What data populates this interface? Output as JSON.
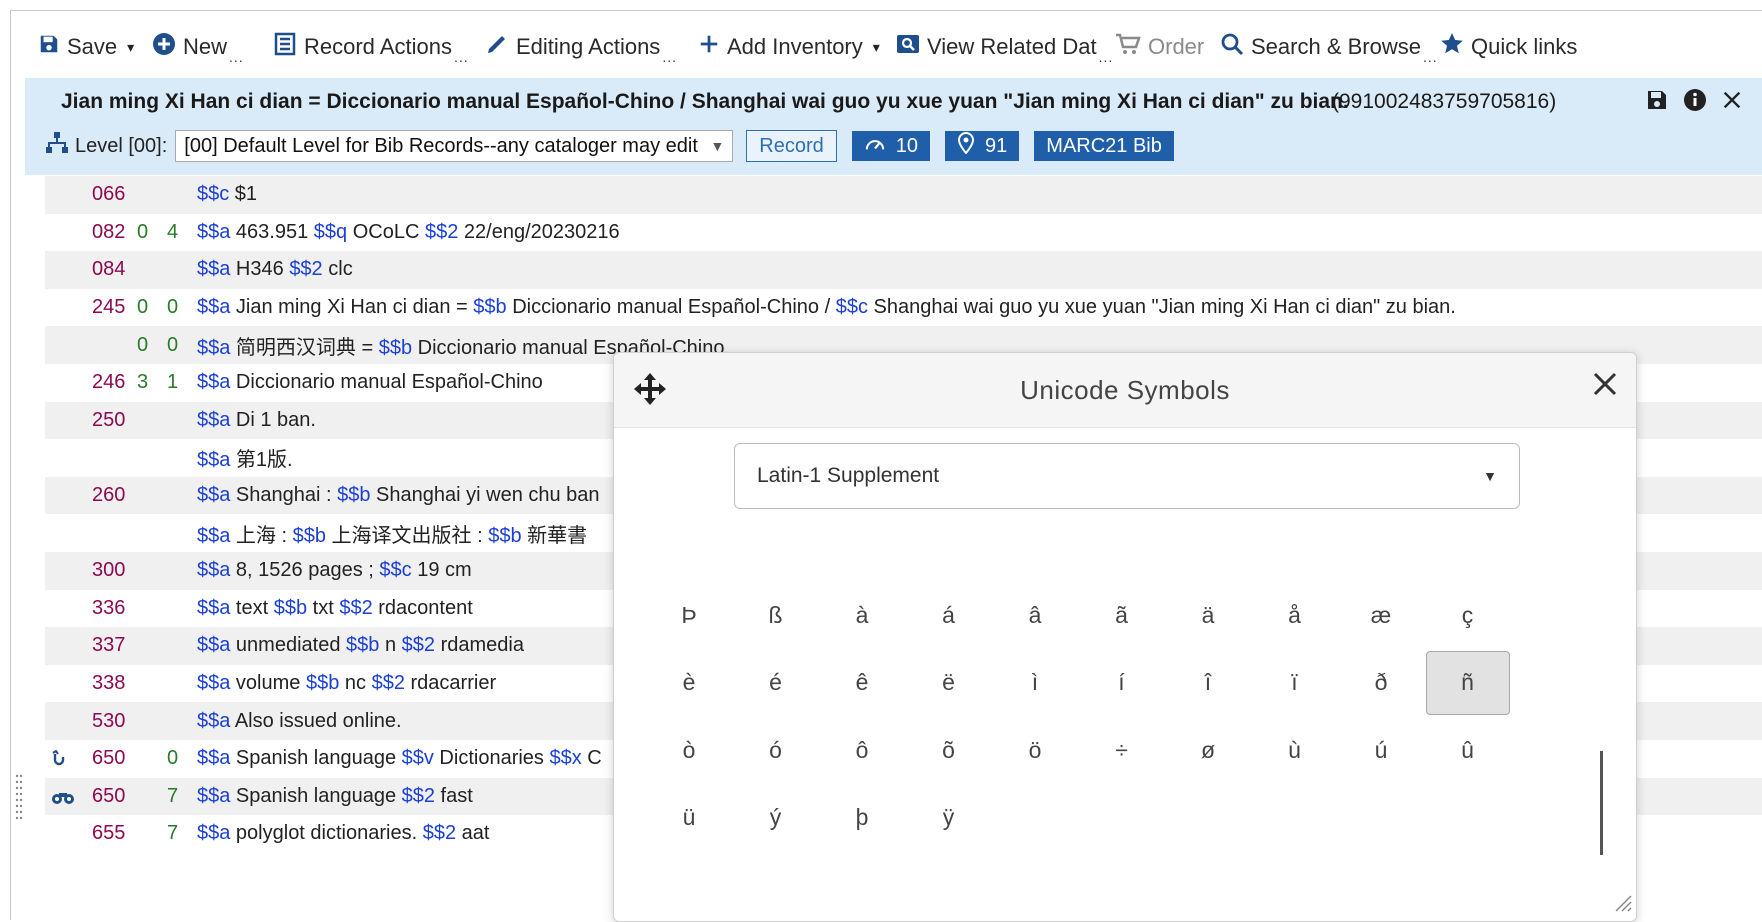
{
  "toolbar": {
    "save": "Save",
    "new": "New",
    "record_actions": "Record Actions",
    "editing_actions": "Editing Actions",
    "add_inventory": "Add Inventory",
    "view_related": "View Related Dat",
    "order": "Order",
    "search_browse": "Search & Browse",
    "quick_links": "Quick links",
    "more": "...",
    "caret": "▾"
  },
  "header": {
    "title": "Jian ming Xi Han ci dian = Diccionario manual Español-Chino / Shanghai wai guo yu xue yuan \"Jian ming Xi Han ci dian\" zu bian.",
    "record_id": "(991002483759705816)",
    "level_label": "Level [00]:",
    "level_value": "[00] Default Level for Bib Records--any cataloger may edit",
    "record_button": "Record",
    "badge_views": "10",
    "badge_location": "91",
    "badge_format": "MARC21 Bib",
    "accent": "#1f5ea8"
  },
  "marc": {
    "rows": [
      {
        "tag": "066",
        "i1": "",
        "i2": "",
        "parts": [
          [
            "$$c",
            " $1"
          ]
        ]
      },
      {
        "tag": "082",
        "i1": "0",
        "i2": "4",
        "parts": [
          [
            "$$a",
            " 463.951 "
          ],
          [
            "$$q",
            " OCoLC "
          ],
          [
            "$$2",
            " 22/eng/20230216"
          ]
        ]
      },
      {
        "tag": "084",
        "i1": "",
        "i2": "",
        "parts": [
          [
            "$$a",
            " H346 "
          ],
          [
            "$$2",
            " clc"
          ]
        ]
      },
      {
        "tag": "245",
        "i1": "0",
        "i2": "0",
        "parts": [
          [
            "$$a",
            " Jian ming Xi Han ci dian = "
          ],
          [
            "$$b",
            " Diccionario manual Español-Chino / "
          ],
          [
            "$$c",
            " Shanghai wai guo yu xue yuan \"Jian ming Xi Han ci dian\" zu bian."
          ]
        ]
      },
      {
        "tag": "",
        "i1": "0",
        "i2": "0",
        "parts": [
          [
            "$$a",
            " 简明西汉词典 = "
          ],
          [
            "$$b",
            " Diccionario manual Español-Chino"
          ]
        ]
      },
      {
        "tag": "246",
        "i1": "3",
        "i2": "1",
        "parts": [
          [
            "$$a",
            " Diccionario manual Español-Chino"
          ]
        ]
      },
      {
        "tag": "250",
        "i1": "",
        "i2": "",
        "parts": [
          [
            "$$a",
            " Di 1 ban."
          ]
        ]
      },
      {
        "tag": "",
        "i1": "",
        "i2": "",
        "parts": [
          [
            "$$a",
            " 第1版."
          ]
        ]
      },
      {
        "tag": "260",
        "i1": "",
        "i2": "",
        "parts": [
          [
            "$$a",
            " Shanghai : "
          ],
          [
            "$$b",
            " Shanghai yi wen chu ban"
          ]
        ]
      },
      {
        "tag": "",
        "i1": "",
        "i2": "",
        "parts": [
          [
            "$$a",
            " 上海 : "
          ],
          [
            "$$b",
            " 上海译文出版社 : "
          ],
          [
            "$$b",
            " 新華書"
          ]
        ]
      },
      {
        "tag": "300",
        "i1": "",
        "i2": "",
        "parts": [
          [
            "$$a",
            " 8, 1526 pages ; "
          ],
          [
            "$$c",
            " 19 cm"
          ]
        ]
      },
      {
        "tag": "336",
        "i1": "",
        "i2": "",
        "parts": [
          [
            "$$a",
            " text "
          ],
          [
            "$$b",
            " txt "
          ],
          [
            "$$2",
            " rdacontent"
          ]
        ]
      },
      {
        "tag": "337",
        "i1": "",
        "i2": "",
        "parts": [
          [
            "$$a",
            " unmediated "
          ],
          [
            "$$b",
            " n "
          ],
          [
            "$$2",
            " rdamedia"
          ]
        ]
      },
      {
        "tag": "338",
        "i1": "",
        "i2": "",
        "parts": [
          [
            "$$a",
            " volume "
          ],
          [
            "$$b",
            " nc "
          ],
          [
            "$$2",
            " rdacarrier"
          ]
        ]
      },
      {
        "tag": "530",
        "i1": "",
        "i2": "",
        "parts": [
          [
            "$$a",
            " Also issued online."
          ]
        ]
      },
      {
        "tag": "650",
        "i1": "",
        "i2": "0",
        "icon": "link-icon",
        "parts": [
          [
            "$$a",
            " Spanish language "
          ],
          [
            "$$v",
            " Dictionaries "
          ],
          [
            "$$x",
            " C"
          ]
        ]
      },
      {
        "tag": "650",
        "i1": "",
        "i2": "7",
        "icon": "binoculars-icon",
        "parts": [
          [
            "$$a",
            " Spanish language "
          ],
          [
            "$$2",
            " fast"
          ]
        ]
      },
      {
        "tag": "655",
        "i1": "",
        "i2": "7",
        "parts": [
          [
            "$$a",
            " polyglot dictionaries. "
          ],
          [
            "$$2",
            " aat"
          ]
        ]
      }
    ]
  },
  "dialog": {
    "title": "Unicode Symbols",
    "block_select": "Latin-1 Supplement",
    "symbols": [
      "Þ",
      "ß",
      "à",
      "á",
      "â",
      "ã",
      "ä",
      "å",
      "æ",
      "ç",
      "è",
      "é",
      "ê",
      "ë",
      "ì",
      "í",
      "î",
      "ï",
      "ð",
      "ñ",
      "ò",
      "ó",
      "ô",
      "õ",
      "ö",
      "÷",
      "ø",
      "ù",
      "ú",
      "û",
      "ü",
      "ý",
      "þ",
      "ÿ"
    ],
    "selected_symbol": "ñ"
  }
}
